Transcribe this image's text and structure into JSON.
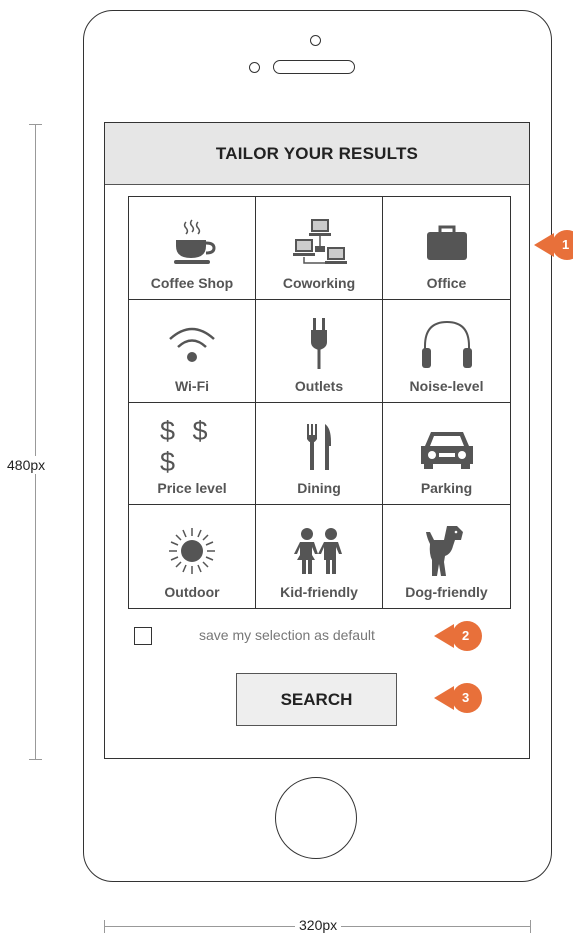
{
  "screen": {
    "title": "TAILOR YOUR RESULTS",
    "categories": [
      {
        "label": "Coffee Shop",
        "icon": "coffee-cup-icon"
      },
      {
        "label": "Coworking",
        "icon": "networked-computers-icon"
      },
      {
        "label": "Office",
        "icon": "briefcase-icon"
      },
      {
        "label": "Wi-Fi",
        "icon": "wifi-icon"
      },
      {
        "label": "Outlets",
        "icon": "power-plug-icon"
      },
      {
        "label": "Noise-level",
        "icon": "headphones-icon"
      },
      {
        "label": "Price level",
        "icon": "dollar-signs-icon",
        "glyph": "$ $ $"
      },
      {
        "label": "Dining",
        "icon": "fork-knife-icon"
      },
      {
        "label": "Parking",
        "icon": "car-icon"
      },
      {
        "label": "Outdoor",
        "icon": "sun-icon"
      },
      {
        "label": "Kid-friendly",
        "icon": "children-icon"
      },
      {
        "label": "Dog-friendly",
        "icon": "dog-icon"
      }
    ],
    "save_default": {
      "label": "save my selection as default",
      "checked": false
    },
    "search_label": "SEARCH"
  },
  "annotations": {
    "markers": [
      "1",
      "2",
      "3"
    ],
    "marker_color": "#e8703a",
    "height_label": "480px",
    "width_label": "320px"
  }
}
